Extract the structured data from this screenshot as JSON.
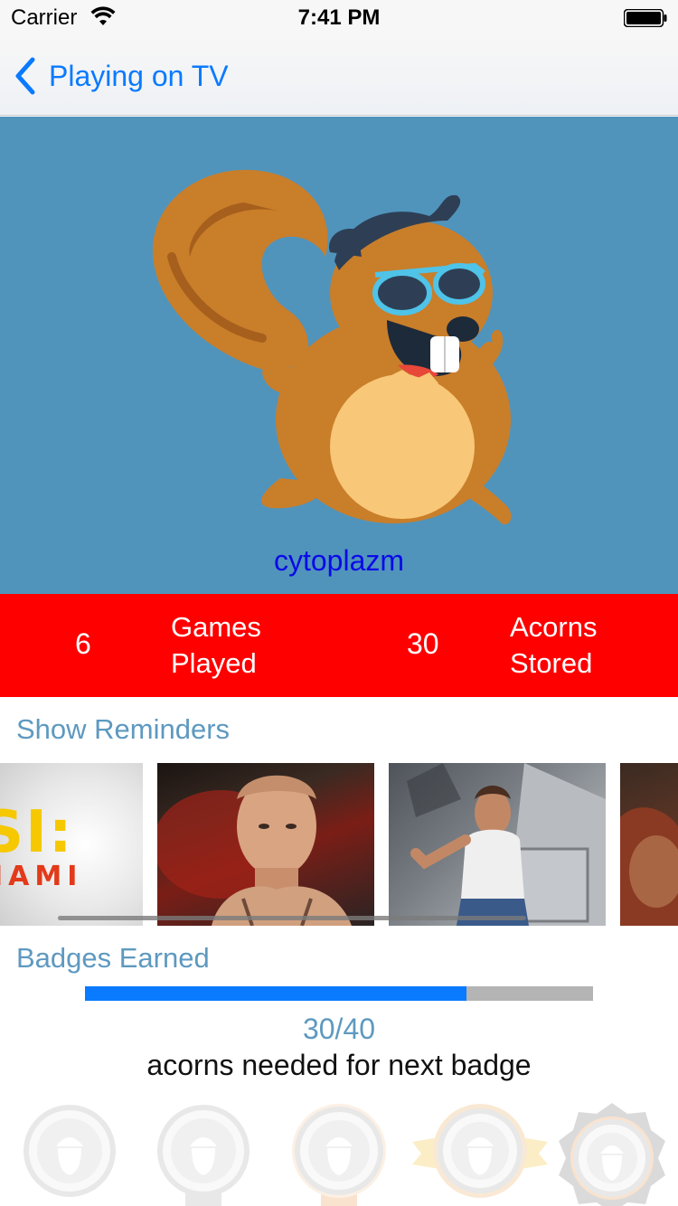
{
  "status_bar": {
    "carrier": "Carrier",
    "time": "7:41 PM",
    "wifi_icon": "wifi-icon",
    "battery_icon": "battery-full-icon"
  },
  "nav": {
    "back_icon": "chevron-left-icon",
    "back_label": "Playing on TV"
  },
  "profile": {
    "avatar_icon": "squirrel-sunglasses-illustration",
    "username": "cytoplazm",
    "hero_color": "#5094bc"
  },
  "stats": {
    "background": "#fe0000",
    "items": [
      {
        "value": "6",
        "label_line1": "Games",
        "label_line2": "Played"
      },
      {
        "value": "30",
        "label_line1": "Acorns",
        "label_line2": "Stored"
      }
    ]
  },
  "reminders": {
    "title": "Show Reminders",
    "posters": [
      {
        "name": "csi-miami-poster",
        "logo_text_top": "SI:",
        "logo_text_bottom": "IAMI"
      },
      {
        "name": "action-movie-poster-1"
      },
      {
        "name": "action-movie-poster-2"
      },
      {
        "name": "action-movie-poster-3"
      }
    ]
  },
  "badges": {
    "title": "Badges Earned",
    "progress_fraction": 0.75,
    "progress_text": "30/40",
    "progress_note": "acorns needed for next badge",
    "accent": "#0a7aff",
    "icons": [
      "acorn-badge-icon",
      "acorn-badge-icon",
      "acorn-badge-icon",
      "acorn-badge-icon",
      "acorn-badge-icon"
    ]
  }
}
